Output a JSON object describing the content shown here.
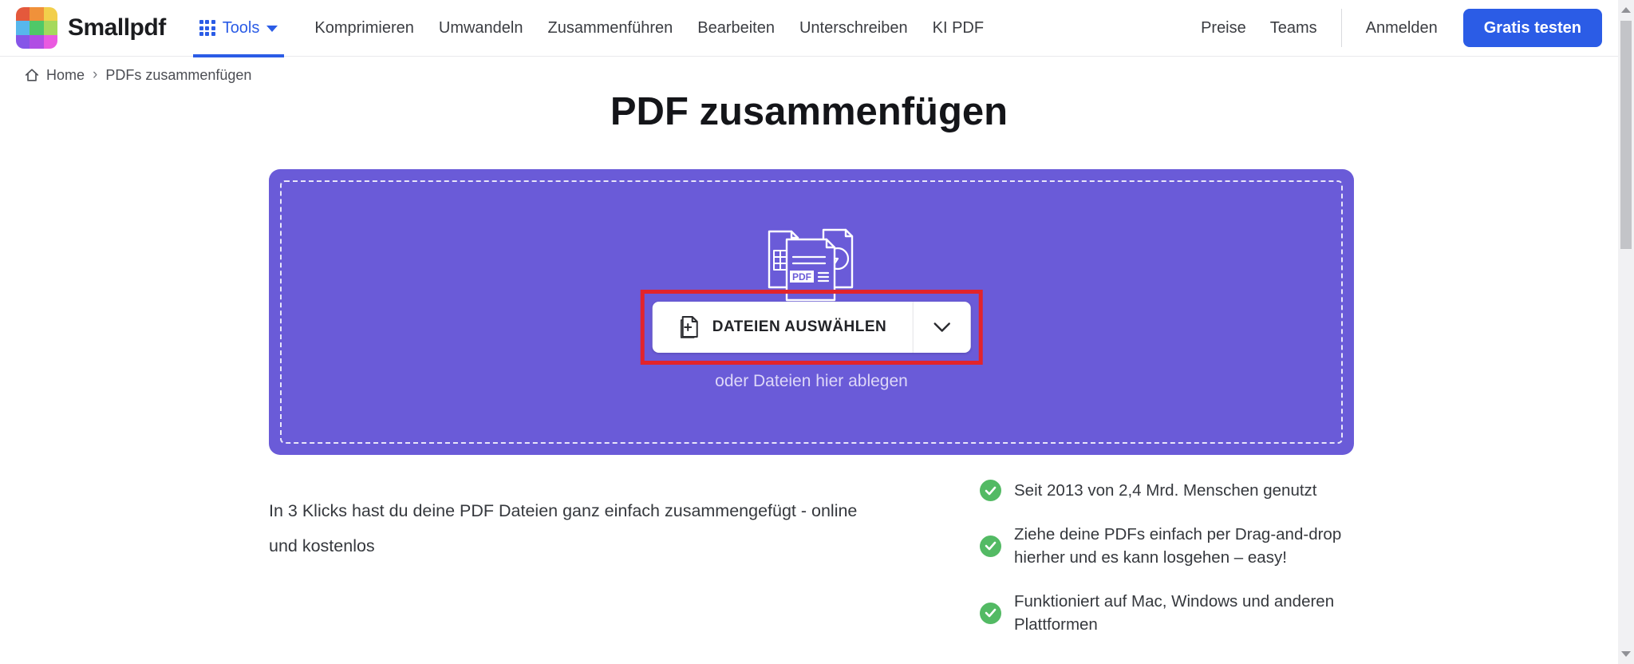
{
  "header": {
    "brand": "Smallpdf",
    "tools_label": "Tools",
    "nav_items": [
      "Komprimieren",
      "Umwandeln",
      "Zusammenführen",
      "Bearbeiten",
      "Unterschreiben",
      "KI PDF"
    ],
    "right_links": [
      "Preise",
      "Teams"
    ],
    "login_label": "Anmelden",
    "cta_label": "Gratis testen"
  },
  "breadcrumb": {
    "home": "Home",
    "separator": "›",
    "current": "PDFs zusammenfügen"
  },
  "page": {
    "title": "PDF zusammenfügen"
  },
  "dropzone": {
    "button_label": "DATEIEN AUSWÄHLEN",
    "hint": "oder Dateien hier ablegen",
    "pdf_badge": "PDF"
  },
  "info": {
    "description": "In 3 Klicks hast du deine PDF Dateien ganz einfach zusammengefügt - online und kostenlos",
    "bullets": [
      "Seit 2013 von 2,4 Mrd. Menschen genutzt",
      "Ziehe deine PDFs einfach per Drag-and-drop hierher und es kann losgehen – easy!",
      "Funktioniert auf Mac, Windows und anderen Plattformen"
    ]
  },
  "colors": {
    "accent_blue": "#2b5ce6",
    "dropzone_purple": "#6a5bd8",
    "annotation_red": "#e2242b",
    "check_green": "#53ba64",
    "logo_tiles": [
      "#e4593c",
      "#f0913a",
      "#f2cf4b",
      "#57b7ec",
      "#4fc868",
      "#a5d95c",
      "#8655e8",
      "#b04ee4",
      "#ea5ae0"
    ]
  }
}
